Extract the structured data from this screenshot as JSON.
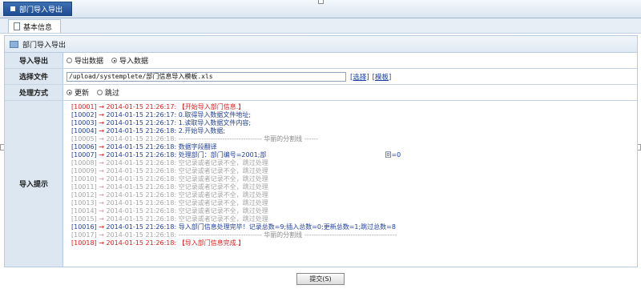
{
  "window": {
    "tab_title": "部门导入导出"
  },
  "subtab": {
    "label": "基本信息"
  },
  "panel": {
    "title": "部门导入导出"
  },
  "form": {
    "import_export": {
      "label": "导入导出",
      "options": [
        {
          "label": "导出数据",
          "selected": false
        },
        {
          "label": "导入数据",
          "selected": true
        }
      ]
    },
    "select_file": {
      "label": "选择文件",
      "value": "/upload/systemplete/部门信息导入模板.xls",
      "select_link": "[选择]",
      "template_link": "[模板]"
    },
    "process_mode": {
      "label": "处理方式",
      "options": [
        {
          "label": "更新",
          "selected": true
        },
        {
          "label": "跳过",
          "selected": false
        }
      ]
    }
  },
  "log": {
    "label": "导入提示",
    "lines": [
      {
        "num": "[10001]",
        "time": "2014-01-15 21:26:17:",
        "msg": "【开始导入部门信息.】",
        "style": "red"
      },
      {
        "num": "[10002]",
        "time": "2014-01-15 21:26:17:",
        "msg": "0.取得导入数据文件地址;",
        "style": "normal"
      },
      {
        "num": "[10003]",
        "time": "2014-01-15 21:26:17:",
        "msg": "1.读取导入数据文件内容;",
        "style": "normal"
      },
      {
        "num": "[10004]",
        "time": "2014-01-15 21:26:18:",
        "msg": "2.开始导入数据;",
        "style": "normal"
      },
      {
        "num": "[10005]",
        "time": "2014-01-15 21:26:18:",
        "msg": "",
        "sep": "华丽的分割线",
        "style": "gray"
      },
      {
        "num": "[10006]",
        "time": "2014-01-15 21:26:18:",
        "msg": "数据字段翻译",
        "style": "normal"
      },
      {
        "num": "[10007]",
        "time": "2014-01-15 21:26:18:",
        "msg": "处理部门：部门编号=2001;部",
        "tail": "回=0",
        "style": "normal"
      },
      {
        "num": "[10008]",
        "time": "2014-01-15 21:26:18:",
        "msg": "空记录或者记录不全，跳过处理",
        "style": "gray"
      },
      {
        "num": "[10009]",
        "time": "2014-01-15 21:26:18:",
        "msg": "空记录或者记录不全，跳过处理",
        "style": "gray"
      },
      {
        "num": "[10010]",
        "time": "2014-01-15 21:26:18:",
        "msg": "空记录或者记录不全，跳过处理",
        "style": "gray"
      },
      {
        "num": "[10011]",
        "time": "2014-01-15 21:26:18:",
        "msg": "空记录或者记录不全，跳过处理",
        "style": "gray"
      },
      {
        "num": "[10012]",
        "time": "2014-01-15 21:26:18:",
        "msg": "空记录或者记录不全，跳过处理",
        "style": "gray"
      },
      {
        "num": "[10013]",
        "time": "2014-01-15 21:26:18:",
        "msg": "空记录或者记录不全，跳过处理",
        "style": "gray"
      },
      {
        "num": "[10014]",
        "time": "2014-01-15 21:26:18:",
        "msg": "空记录或者记录不全，跳过处理",
        "style": "gray"
      },
      {
        "num": "[10015]",
        "time": "2014-01-15 21:26:18:",
        "msg": "空记录或者记录不全，跳过处理",
        "style": "gray"
      },
      {
        "num": "[10016]",
        "time": "2014-01-15 21:26:18:",
        "msg": "导入部门信息处理完毕！记录总数=9;插入总数=0;更新总数=1;跳过总数=8",
        "style": "normal"
      },
      {
        "num": "[10017]",
        "time": "2014-01-15 21:26:18:",
        "msg": "",
        "sep": "华丽的分割线",
        "style": "gray"
      },
      {
        "num": "[10018]",
        "time": "2014-01-15 21:26:18:",
        "msg": "【导入部门信息完成.】",
        "style": "red"
      }
    ]
  },
  "submit_label": "提交(S)",
  "colors": {
    "header_blue": "#1d4d92",
    "label_bg": "#dde7f2",
    "log_red": "#d81e1e",
    "log_blue": "#1f3f9a"
  }
}
